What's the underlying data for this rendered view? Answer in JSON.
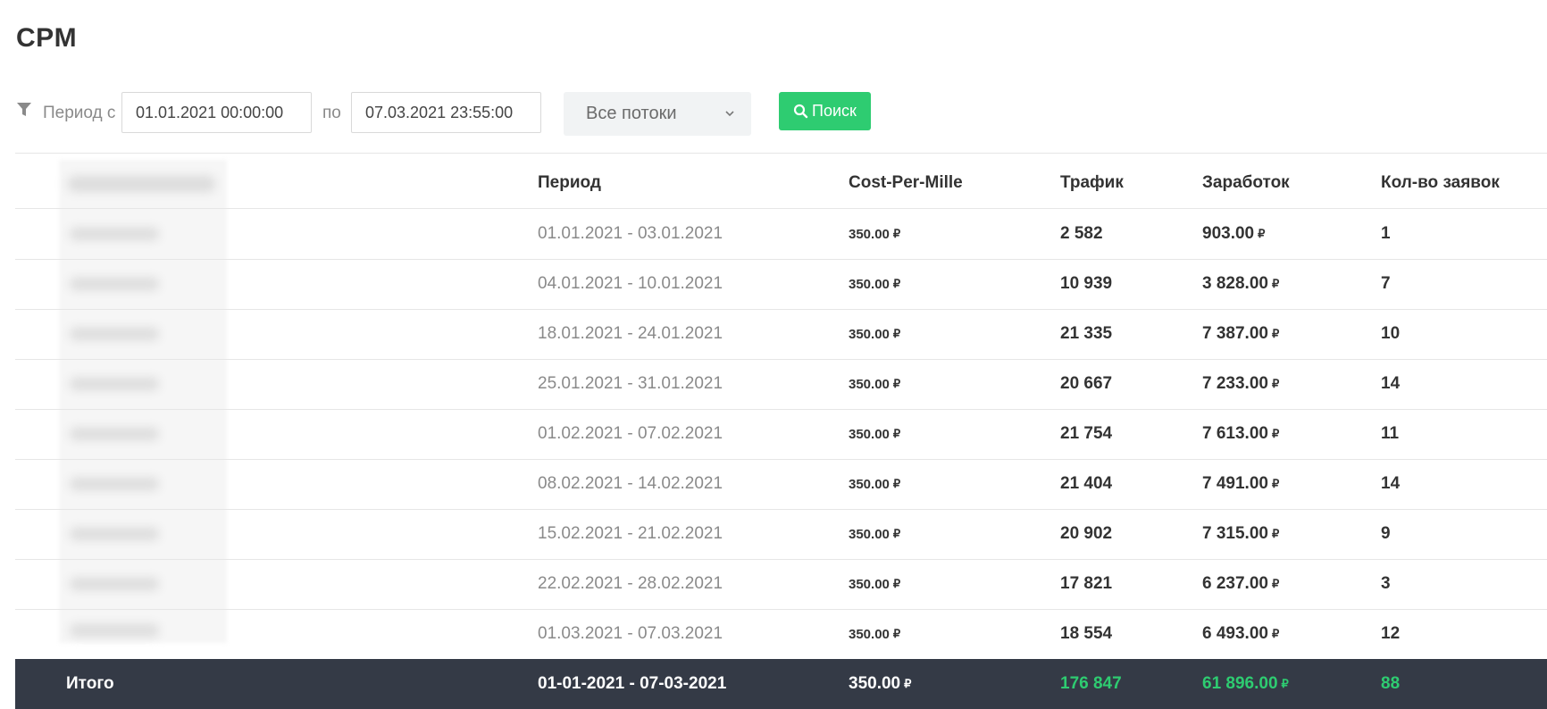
{
  "page": {
    "title": "CPM"
  },
  "filter": {
    "icon": "filter-icon",
    "period_from_label": "Период с",
    "date_from": "01.01.2021 00:00:00",
    "to_label": "по",
    "date_to": "07.03.2021 23:55:00",
    "stream_select": {
      "value": "Все потоки",
      "icon": "chevron-down-icon"
    },
    "search_button": {
      "label": "Поиск",
      "icon": "search-icon"
    }
  },
  "table": {
    "headers": {
      "period": "Период",
      "cpm": "Cost-Per-Mille",
      "traffic": "Трафик",
      "earnings": "Заработок",
      "orders": "Кол-во заявок"
    },
    "currency": "₽",
    "rows": [
      {
        "period": "01.01.2021 - 03.01.2021",
        "cpm": "350.00",
        "traffic": "2 582",
        "earnings": "903.00",
        "orders": "1"
      },
      {
        "period": "04.01.2021 - 10.01.2021",
        "cpm": "350.00",
        "traffic": "10 939",
        "earnings": "3 828.00",
        "orders": "7"
      },
      {
        "period": "18.01.2021 - 24.01.2021",
        "cpm": "350.00",
        "traffic": "21 335",
        "earnings": "7 387.00",
        "orders": "10"
      },
      {
        "period": "25.01.2021 - 31.01.2021",
        "cpm": "350.00",
        "traffic": "20 667",
        "earnings": "7 233.00",
        "orders": "14"
      },
      {
        "period": "01.02.2021 - 07.02.2021",
        "cpm": "350.00",
        "traffic": "21 754",
        "earnings": "7 613.00",
        "orders": "11"
      },
      {
        "period": "08.02.2021 - 14.02.2021",
        "cpm": "350.00",
        "traffic": "21 404",
        "earnings": "7 491.00",
        "orders": "14"
      },
      {
        "period": "15.02.2021 - 21.02.2021",
        "cpm": "350.00",
        "traffic": "20 902",
        "earnings": "7 315.00",
        "orders": "9"
      },
      {
        "period": "22.02.2021 - 28.02.2021",
        "cpm": "350.00",
        "traffic": "17 821",
        "earnings": "6 237.00",
        "orders": "3"
      },
      {
        "period": "01.03.2021 - 07.03.2021",
        "cpm": "350.00",
        "traffic": "18 554",
        "earnings": "6 493.00",
        "orders": "12"
      }
    ],
    "total": {
      "label": "Итого",
      "period": "01-01-2021 - 07-03-2021",
      "cpm": "350.00",
      "traffic": "176 847",
      "earnings": "61 896.00",
      "orders": "88"
    }
  },
  "colors": {
    "accent": "#2ecc71",
    "total_row_bg": "#343a46",
    "muted_text": "#8a8a8a"
  }
}
